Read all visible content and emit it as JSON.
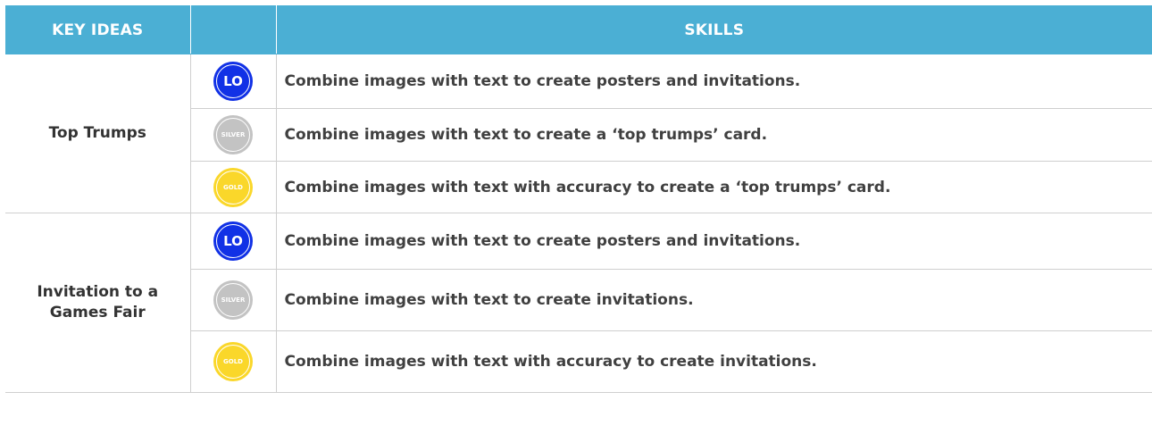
{
  "header": {
    "key_ideas": "KEY IDEAS",
    "skills": "SKILLS"
  },
  "groups": [
    {
      "key_idea": "Top Trumps",
      "rows": [
        {
          "badge": "LO",
          "level": "lo",
          "skill": "Combine images with text to create posters and invitations."
        },
        {
          "badge": "SILVER",
          "level": "silver",
          "skill": "Combine images with text to create a ‘top trumps’ card."
        },
        {
          "badge": "GOLD",
          "level": "gold",
          "skill": "Combine images with text with accuracy to create a ‘top trumps’ card."
        }
      ]
    },
    {
      "key_idea_line1": "Invitation to a",
      "key_idea_line2": "Games Fair",
      "rows": [
        {
          "badge": "LO",
          "level": "lo",
          "skill": "Combine images with text to create posters and invitations."
        },
        {
          "badge": "SILVER",
          "level": "silver",
          "skill": "Combine images with text to create invitations."
        },
        {
          "badge": "GOLD",
          "level": "gold",
          "skill": "Combine images with text with accuracy to create invitations."
        }
      ]
    }
  ],
  "colors": {
    "header_bg": "#4bafd4",
    "lo": "#1131e6",
    "silver": "#c3c3c3",
    "gold": "#fad72a"
  }
}
